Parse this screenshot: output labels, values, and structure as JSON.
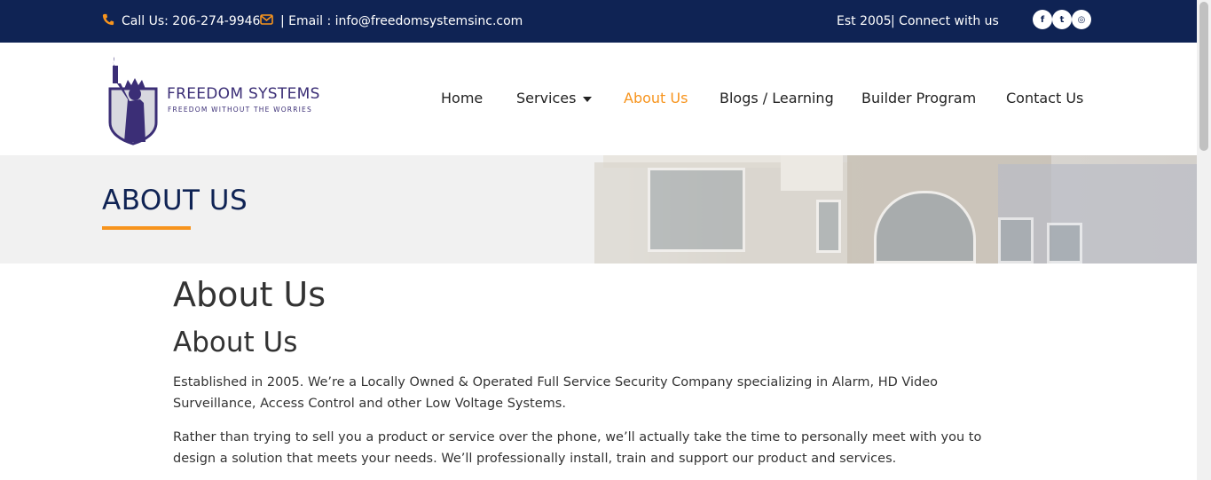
{
  "topbar": {
    "phone_label": "Call Us: 206-274-9946",
    "email_label": "| Email : info@freedomsystemsinc.com",
    "est_label": "Est 2005",
    "connect_label": "| Connect with us",
    "social": [
      {
        "name": "facebook-icon",
        "glyph": "f"
      },
      {
        "name": "twitter-icon",
        "glyph": "t"
      },
      {
        "name": "instagram-icon",
        "glyph": "◎"
      }
    ]
  },
  "logo": {
    "brand": "FREEDOM SYSTEMS",
    "tagline": "FREEDOM WITHOUT THE WORRIES"
  },
  "nav": {
    "items": [
      {
        "label": "Home"
      },
      {
        "label": "Services"
      },
      {
        "label": "About Us"
      },
      {
        "label": "Blogs / Learning"
      },
      {
        "label": "Builder Program"
      },
      {
        "label": "Contact Us"
      }
    ]
  },
  "banner": {
    "title": "ABOUT US"
  },
  "content": {
    "heading1": "About Us",
    "heading2": "About Us",
    "paragraphs": [
      "Established in 2005. We’re a Locally Owned & Operated Full Service Security Company specializing in Alarm, HD Video Surveillance, Access Control and other Low Voltage Systems.",
      "Rather than trying to sell you a product or service over the phone, we’ll actually take the time to personally meet with you to design a solution that meets your needs. We’ll professionally install, train and support our product and services."
    ]
  },
  "colors": {
    "navy": "#0f2354",
    "accent": "#f7941d",
    "text": "#333333"
  }
}
